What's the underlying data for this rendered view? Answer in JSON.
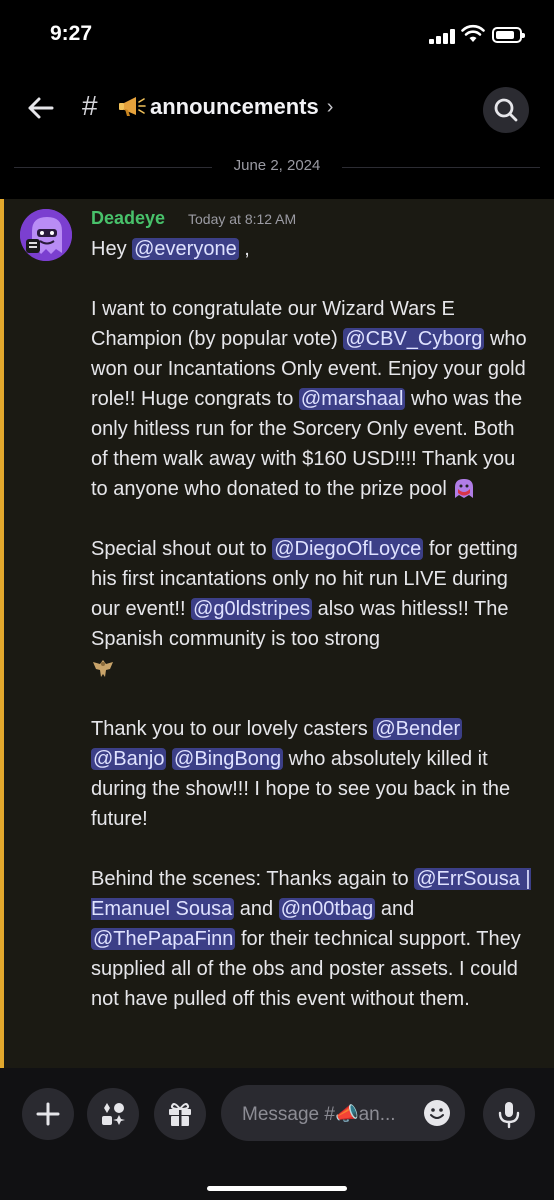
{
  "status": {
    "time": "9:27"
  },
  "header": {
    "hash": "#",
    "channel": "announcements",
    "chevron": "›",
    "channel_icon": "megaphone-emoji",
    "search_icon": "search-icon"
  },
  "divider": {
    "date": "June 2, 2024"
  },
  "message": {
    "author": "Deadeye",
    "timestamp": "Today at 8:12 AM",
    "author_color": "#48c26b",
    "mention_color": "#3c3f87",
    "highlight_bar_color": "#e2a82d",
    "lines": {
      "l1a": "Hey ",
      "l1m": "@everyone",
      "l1b": " ,",
      "p1a": "I want to congratulate our Wizard Wars E Champion (by popular vote) ",
      "p1m1": "@CBV_Cyborg",
      "p1b": " who won our Incantations Only event. Enjoy your gold role!! Huge congrats to ",
      "p1m2": "@marshaal",
      "p1c": " who was the only hitless run for the Sorcery Only event. Both of them walk away with $160 USD!!!! Thank you to anyone who donated to the prize pool ",
      "p2a": "Special shout out to ",
      "p2m1": "@DiegoOfLoyce",
      "p2b": " for getting his first incantations only no hit run LIVE during our event!! ",
      "p2m2": "@g0ldstripes",
      "p2c": " also was hitless!! The Spanish community is too strong",
      "p3a": "Thank you to our lovely casters ",
      "p3m1": "@Bender",
      "p3m2": "@Banjo",
      "p3m3": "@BingBong",
      "p3b": " who absolutely killed it during the show!!! I hope to see you back in the future!",
      "p4a": "Behind the scenes: Thanks again to ",
      "p4m1": "@ErrSousa | Emanuel Sousa",
      "p4b": " and ",
      "p4m2": "@n00tbag",
      "p4c": " and ",
      "p4m3": "@ThePapaFinn",
      "p4d": " for their technical support. They supplied all of the obs and poster assets. I could not have pulled off this event without them."
    }
  },
  "composer": {
    "placeholder": "Message #📣an...",
    "buttons": [
      "plus-icon",
      "apps-icon",
      "gift-icon",
      "emoji-icon",
      "microphone-icon"
    ]
  }
}
